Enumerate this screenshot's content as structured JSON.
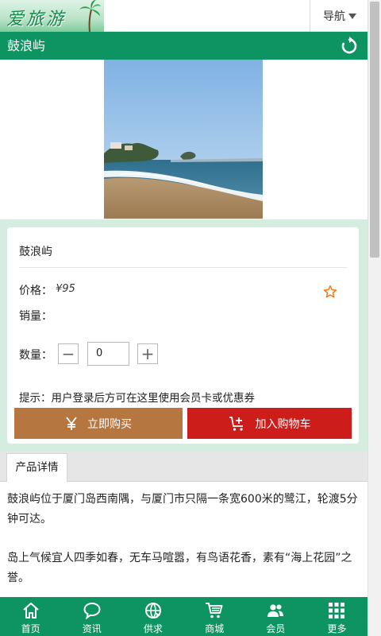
{
  "header": {
    "logo_text": "爱旅游",
    "nav_label": "导航"
  },
  "titlebar": {
    "title": "鼓浪屿"
  },
  "product": {
    "name": "鼓浪屿",
    "price_label": "价格：",
    "price_value": "¥95",
    "sales_label": "销量：",
    "qty_label": "数量：",
    "qty_value": "0",
    "qty_minus": "−",
    "qty_plus": "+",
    "tip": "提示：用户登录后方可在这里使用会员卡或优惠券",
    "buy_label": "立即购买",
    "cart_label": "加入购物车"
  },
  "detail": {
    "tab_label": "产品详情",
    "paragraphs": [
      "鼓浪屿位于厦门岛西南隅，与厦门市只隔一条宽600米的鹭江，轮渡5分钟可达。",
      "岛上气候宜人四季如春，无车马喧嚣，有鸟语花香，素有“海上花园”之誉。"
    ]
  },
  "bottom_nav": [
    {
      "label": "首页",
      "icon": "home-icon"
    },
    {
      "label": "资讯",
      "icon": "chat-bubble-icon"
    },
    {
      "label": "供求",
      "icon": "globe-icon"
    },
    {
      "label": "商城",
      "icon": "shopping-cart-icon"
    },
    {
      "label": "会员",
      "icon": "members-icon"
    },
    {
      "label": "更多",
      "icon": "grid-icon"
    }
  ],
  "colors": {
    "brand_green": "#0e9463",
    "buy_brown": "#b67640",
    "cart_red": "#cc1d1a",
    "card_bg": "#d4ede0",
    "star_orange": "#f07a1a"
  }
}
